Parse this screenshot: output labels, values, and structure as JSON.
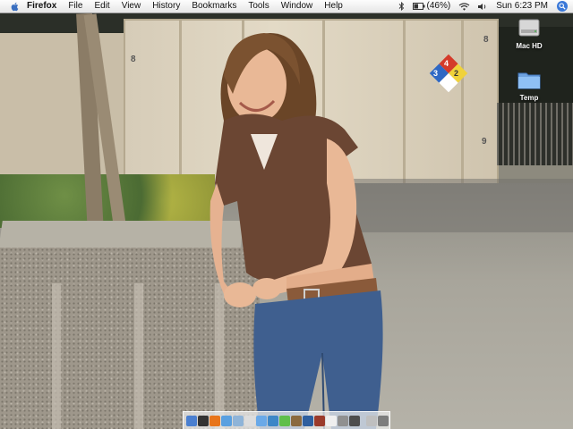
{
  "menubar": {
    "apple_icon": "apple-icon",
    "app_name": "Firefox",
    "menus": [
      "File",
      "Edit",
      "View",
      "History",
      "Bookmarks",
      "Tools",
      "Window",
      "Help"
    ],
    "status": {
      "bluetooth_icon": "bluetooth-icon",
      "battery_icon": "battery-icon",
      "battery_text": "(46%)",
      "wifi_icon": "wifi-icon",
      "volume_icon": "volume-icon",
      "clock": "Sun 6:23 PM",
      "spotlight_icon": "spotlight-icon"
    }
  },
  "desktop": {
    "icons": [
      {
        "label": "Mac HD",
        "icon": "hard-drive-icon"
      },
      {
        "label": "Temp",
        "icon": "folder-icon"
      }
    ],
    "container_numbers": [
      "8",
      "8",
      "9"
    ],
    "hazard_diamond": [
      "4",
      "3",
      "2"
    ]
  },
  "dock": {
    "items": [
      {
        "icon": "finder-icon",
        "color": "#4a7fd0"
      },
      {
        "icon": "dashboard-icon",
        "color": "#333333"
      },
      {
        "icon": "firefox-icon",
        "color": "#e8751a"
      },
      {
        "icon": "safari-icon",
        "color": "#5aa0e0"
      },
      {
        "icon": "mail-icon",
        "color": "#8fb4d8"
      },
      {
        "icon": "ical-icon",
        "color": "#dddddd"
      },
      {
        "icon": "itunes-icon",
        "color": "#6aa9e8"
      },
      {
        "icon": "iphoto-icon",
        "color": "#3e87c7"
      },
      {
        "icon": "ichat-icon",
        "color": "#5fbf4a"
      },
      {
        "icon": "address-book-icon",
        "color": "#8b6a3f"
      },
      {
        "icon": "preview-icon",
        "color": "#2f5f9f"
      },
      {
        "icon": "photo-booth-icon",
        "color": "#9b3b2b"
      },
      {
        "icon": "textedit-icon",
        "color": "#efefef"
      },
      {
        "icon": "system-preferences-icon",
        "color": "#909090"
      },
      {
        "icon": "app-icon",
        "color": "#4d4d4d"
      },
      {
        "icon": "documents-icon",
        "color": "#bfbfbf"
      },
      {
        "icon": "trash-icon",
        "color": "#7d7d7d"
      }
    ]
  }
}
